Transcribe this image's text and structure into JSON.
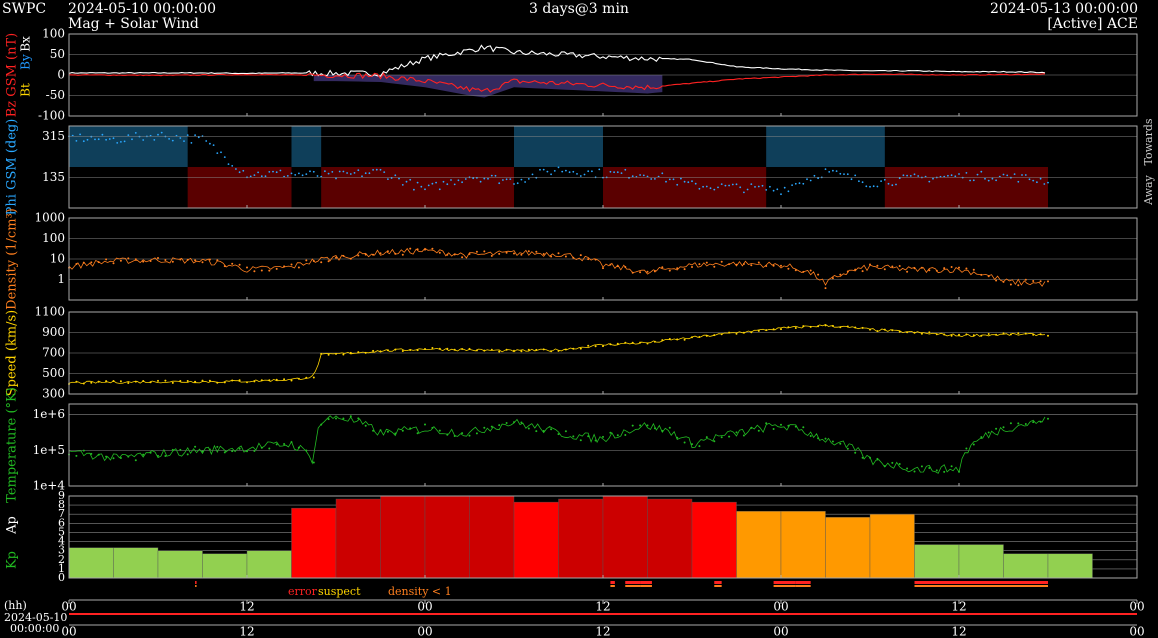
{
  "header": {
    "org": "SWPC",
    "start": "2024-05-10 00:00:00",
    "title": "Mag + Solar Wind",
    "span": "3 days@3 min",
    "end": "2024-05-13 00:00:00",
    "source": "[Active] ACE"
  },
  "colors": {
    "bz": "#ff2222",
    "bt": "#ffffff",
    "by": "#2299ff",
    "bx": "#ffd700",
    "phi": "#2aa8ff",
    "density": "#ff7f1e",
    "speed": "#ffd400",
    "temperature": "#22bb22",
    "kp": "#22bb22",
    "ap": "#ffffff",
    "kp_low": "#92d050",
    "kp_mid": "#ff9900",
    "kp_high": "#ff0000",
    "kp_extreme": "#cc0000",
    "bz_fill": "#3a2f6a",
    "phi_toward": "#0f3f5a",
    "phi_away": "#5a0000",
    "error": "#ff2222",
    "suspect": "#ffd400",
    "density_lt1": "#ff7f1e"
  },
  "chart_data": [
    {
      "type": "line",
      "panel": "mag",
      "ylabel": "Bz GSM (nT)",
      "legend": [
        "Bt",
        "By",
        "Bx"
      ],
      "ylim": [
        -100,
        100
      ],
      "yticks": [
        "100",
        "50",
        "0",
        "-50",
        "-100"
      ],
      "x_hours": [
        0,
        3,
        6,
        9,
        12,
        15,
        18,
        21,
        24,
        27,
        28,
        30,
        33,
        36,
        39,
        42,
        45,
        48,
        51,
        54,
        57,
        60,
        63,
        66,
        69,
        72
      ],
      "series": [
        {
          "name": "Bt",
          "values": [
            5,
            5,
            5,
            5,
            4,
            5,
            4,
            4,
            40,
            60,
            68,
            55,
            50,
            45,
            40,
            38,
            20,
            15,
            12,
            10,
            10,
            8,
            8,
            6,
            6,
            5
          ]
        },
        {
          "name": "Bz",
          "values": [
            0,
            0,
            -1,
            0,
            1,
            0,
            0,
            -2,
            -15,
            -35,
            -40,
            -15,
            -20,
            -25,
            -30,
            -20,
            -10,
            -5,
            0,
            2,
            1,
            0,
            1,
            2,
            1,
            2
          ]
        }
      ]
    },
    {
      "type": "scatter",
      "panel": "phi",
      "ylabel": "Phi GSM (deg)",
      "side_labels": [
        "Away",
        "Towards"
      ],
      "yticks": [
        "315",
        "135"
      ],
      "ylim": [
        0,
        360
      ],
      "x_hours": [
        0,
        3,
        6,
        9,
        12,
        15,
        18,
        21,
        24,
        27,
        30,
        33,
        36,
        39,
        42,
        45,
        48,
        51,
        54,
        57,
        60,
        63,
        66,
        69,
        72
      ],
      "values": [
        310,
        300,
        320,
        300,
        150,
        150,
        140,
        160,
        80,
        140,
        120,
        170,
        150,
        150,
        100,
        90,
        80,
        160,
        110,
        130,
        140,
        140,
        120,
        130,
        70
      ]
    },
    {
      "type": "line",
      "panel": "density",
      "ylabel": "Density (1/cm³)",
      "yscale": "log",
      "ylim": [
        0.1,
        1000
      ],
      "yticks": [
        "1000",
        "100",
        "10",
        "1"
      ],
      "x_hours": [
        0,
        3,
        6,
        9,
        12,
        15,
        18,
        21,
        24,
        27,
        30,
        33,
        36,
        39,
        42,
        45,
        48,
        51,
        54,
        57,
        60,
        63,
        66,
        69,
        72
      ],
      "values": [
        4,
        8,
        9,
        8,
        3,
        4,
        12,
        20,
        25,
        15,
        20,
        18,
        5,
        2,
        5,
        6,
        5,
        0.5,
        4,
        3,
        3,
        0.8,
        0.6,
        0.7,
        1.1
      ]
    },
    {
      "type": "line",
      "panel": "speed",
      "ylabel": "Speed (km/s)",
      "ylim": [
        300,
        1100
      ],
      "yticks": [
        "1100",
        "900",
        "700",
        "500",
        "300"
      ],
      "x_hours": [
        0,
        3,
        6,
        9,
        12,
        15,
        16.5,
        17,
        21,
        24,
        27,
        30,
        33,
        36,
        39,
        42,
        45,
        48,
        51,
        54,
        57,
        60,
        63,
        66,
        69,
        72
      ],
      "values": [
        410,
        415,
        420,
        420,
        425,
        440,
        470,
        680,
        720,
        740,
        730,
        720,
        730,
        780,
        800,
        850,
        900,
        940,
        970,
        930,
        900,
        870,
        880,
        880,
        870,
        900
      ]
    },
    {
      "type": "line",
      "panel": "temperature",
      "ylabel": "Temperature (°K)",
      "yscale": "log",
      "ylim": [
        10000,
        2000000
      ],
      "yticks": [
        "1e+6",
        "1e+5",
        "1e+4"
      ],
      "x_hours": [
        0,
        3,
        6,
        9,
        12,
        15,
        16.5,
        17,
        18,
        21,
        24,
        27,
        30,
        33,
        36,
        39,
        42,
        45,
        48,
        51,
        54,
        57,
        60,
        63,
        66,
        69,
        72
      ],
      "values": [
        90000,
        60000,
        80000,
        100000,
        120000,
        150000,
        50000,
        600000,
        900000,
        300000,
        400000,
        300000,
        600000,
        300000,
        200000,
        500000,
        150000,
        300000,
        500000,
        200000,
        50000,
        30000,
        30000,
        400000,
        700000,
        800000,
        900000
      ]
    },
    {
      "type": "bar",
      "panel": "kp",
      "ylabel": "Kp Ap",
      "ylim": [
        0,
        9
      ],
      "yticks": [
        "9",
        "8",
        "7",
        "6",
        "5",
        "4",
        "3",
        "2",
        "1",
        "0"
      ],
      "categories": [
        "00",
        "03",
        "06",
        "09",
        "12",
        "15",
        "18",
        "21",
        "00",
        "03",
        "06",
        "09",
        "12",
        "15",
        "18",
        "21",
        "00",
        "03",
        "06",
        "09",
        "12",
        "15",
        "18",
        "21"
      ],
      "values": [
        3.33,
        3.33,
        3.0,
        2.67,
        3.0,
        7.67,
        8.67,
        9.0,
        9.0,
        9.0,
        8.33,
        8.67,
        9.0,
        8.67,
        8.33,
        7.33,
        7.33,
        6.67,
        7.0,
        3.67,
        3.67,
        2.67,
        2.67,
        0
      ]
    }
  ],
  "flags": {
    "legend": [
      "error",
      "suspect",
      "density < 1"
    ]
  },
  "axis": {
    "hh_label": "(hh)",
    "date_label": "2024-05-10",
    "time_label": "00:00:00",
    "ticks": [
      "00",
      "12",
      "00",
      "12",
      "00",
      "12",
      "00"
    ]
  }
}
